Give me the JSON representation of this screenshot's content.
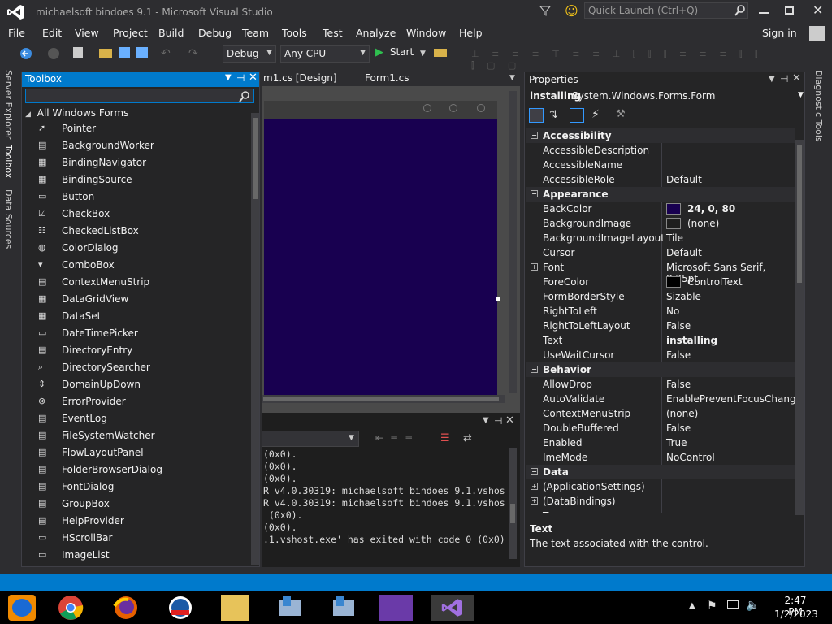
{
  "titlebar": {
    "title": "michaelsoft bindoes 9.1 - Microsoft Visual Studio",
    "quick_launch_placeholder": "Quick Launch (Ctrl+Q)"
  },
  "menu": [
    "File",
    "Edit",
    "View",
    "Project",
    "Build",
    "Debug",
    "Team",
    "Tools",
    "Test",
    "Analyze",
    "Window",
    "Help"
  ],
  "sign_in": "Sign in",
  "toolbar": {
    "config": "Debug",
    "platform": "Any CPU",
    "start": "Start"
  },
  "side_tabs": [
    "Server Explorer",
    "Toolbox",
    "Data Sources"
  ],
  "right_side_tab": "Diagnostic Tools",
  "toolbox": {
    "title": "Toolbox",
    "group": "All Windows Forms",
    "items": [
      "Pointer",
      "BackgroundWorker",
      "BindingNavigator",
      "BindingSource",
      "Button",
      "CheckBox",
      "CheckedListBox",
      "ColorDialog",
      "ComboBox",
      "ContextMenuStrip",
      "DataGridView",
      "DataSet",
      "DateTimePicker",
      "DirectoryEntry",
      "DirectorySearcher",
      "DomainUpDown",
      "ErrorProvider",
      "EventLog",
      "FileSystemWatcher",
      "FlowLayoutPanel",
      "FolderBrowserDialog",
      "FontDialog",
      "GroupBox",
      "HelpProvider",
      "HScrollBar",
      "ImageList"
    ]
  },
  "doc_tabs": [
    "m1.cs [Design]",
    "Form1.cs"
  ],
  "form_color": "#180050",
  "output_lines": [
    "(0x0).",
    "(0x0).",
    "(0x0).",
    "R v4.0.30319: michaelsoft bindoes 9.1.vshos",
    "R v4.0.30319: michaelsoft bindoes 9.1.vshos",
    " (0x0).",
    "(0x0).",
    ".1.vshost.exe' has exited with code 0 (0x0)"
  ],
  "properties": {
    "title": "Properties",
    "object_name": "installing",
    "object_type": "System.Windows.Forms.Form",
    "rows": [
      {
        "kind": "cat",
        "name": "Accessibility"
      },
      {
        "name": "AccessibleDescription",
        "value": ""
      },
      {
        "name": "AccessibleName",
        "value": ""
      },
      {
        "name": "AccessibleRole",
        "value": "Default"
      },
      {
        "kind": "cat",
        "name": "Appearance"
      },
      {
        "name": "BackColor",
        "value": "24, 0, 80",
        "swatch": "#180050",
        "bold": true
      },
      {
        "name": "BackgroundImage",
        "value": "(none)",
        "swatch": "#1e1e1e"
      },
      {
        "name": "BackgroundImageLayout",
        "value": "Tile"
      },
      {
        "name": "Cursor",
        "value": "Default"
      },
      {
        "name": "Font",
        "value": "Microsoft Sans Serif, 8.25pt",
        "expand": true
      },
      {
        "name": "ForeColor",
        "value": "ControlText",
        "swatch": "#000000"
      },
      {
        "name": "FormBorderStyle",
        "value": "Sizable"
      },
      {
        "name": "RightToLeft",
        "value": "No"
      },
      {
        "name": "RightToLeftLayout",
        "value": "False"
      },
      {
        "name": "Text",
        "value": "installing",
        "bold": true
      },
      {
        "name": "UseWaitCursor",
        "value": "False"
      },
      {
        "kind": "cat",
        "name": "Behavior"
      },
      {
        "name": "AllowDrop",
        "value": "False"
      },
      {
        "name": "AutoValidate",
        "value": "EnablePreventFocusChange"
      },
      {
        "name": "ContextMenuStrip",
        "value": "(none)"
      },
      {
        "name": "DoubleBuffered",
        "value": "False"
      },
      {
        "name": "Enabled",
        "value": "True"
      },
      {
        "name": "ImeMode",
        "value": "NoControl"
      },
      {
        "kind": "cat",
        "name": "Data"
      },
      {
        "name": "(ApplicationSettings)",
        "value": "",
        "expand": true
      },
      {
        "name": "(DataBindings)",
        "value": "",
        "expand": true
      },
      {
        "name": "Tag",
        "value": ""
      }
    ],
    "desc_title": "Text",
    "desc_text": "The text associated with the control."
  },
  "clock": {
    "time": "2:47 PM",
    "date": "1/2/2023"
  },
  "colors": {
    "accent": "#007acc",
    "bg": "#2d2d30",
    "panel": "#252526"
  }
}
